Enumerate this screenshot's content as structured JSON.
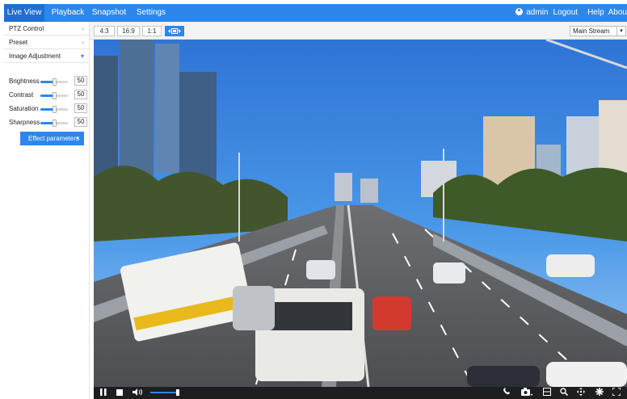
{
  "nav": {
    "tabs": [
      {
        "label": "Live View",
        "active": true
      },
      {
        "label": "Playback",
        "active": false
      },
      {
        "label": "Snapshot",
        "active": false
      },
      {
        "label": "Settings",
        "active": false
      }
    ],
    "user": "admin",
    "logout": "Logout",
    "help": "Help",
    "about": "Abou"
  },
  "sidebar": {
    "ptz_control": "PTZ Control",
    "preset": "Preset",
    "image_adjustment": "Image Adjustment",
    "adjustments": [
      {
        "label": "Brightness",
        "value": "50"
      },
      {
        "label": "Contrast",
        "value": "50"
      },
      {
        "label": "Saturation",
        "value": "50"
      },
      {
        "label": "Sharpness",
        "value": "50"
      }
    ],
    "effect_button": "Effect parameters"
  },
  "toolbar": {
    "ratios": [
      "4:3",
      "16:9",
      "1:1"
    ],
    "stream": "Main Stream"
  },
  "icons": {
    "pause": "pause-icon",
    "stop": "stop-icon",
    "volume": "volume-icon",
    "talk": "phone-icon",
    "snapshot": "camera-icon",
    "record": "record-icon",
    "zoom": "zoom-icon",
    "ptz": "ptz-icon",
    "settings": "gear-icon",
    "fullscreen": "fullscreen-icon"
  },
  "colors": {
    "accent": "#2d87ea",
    "nav_active": "#1f6fcf",
    "control_bar": "#1e1e1e"
  }
}
